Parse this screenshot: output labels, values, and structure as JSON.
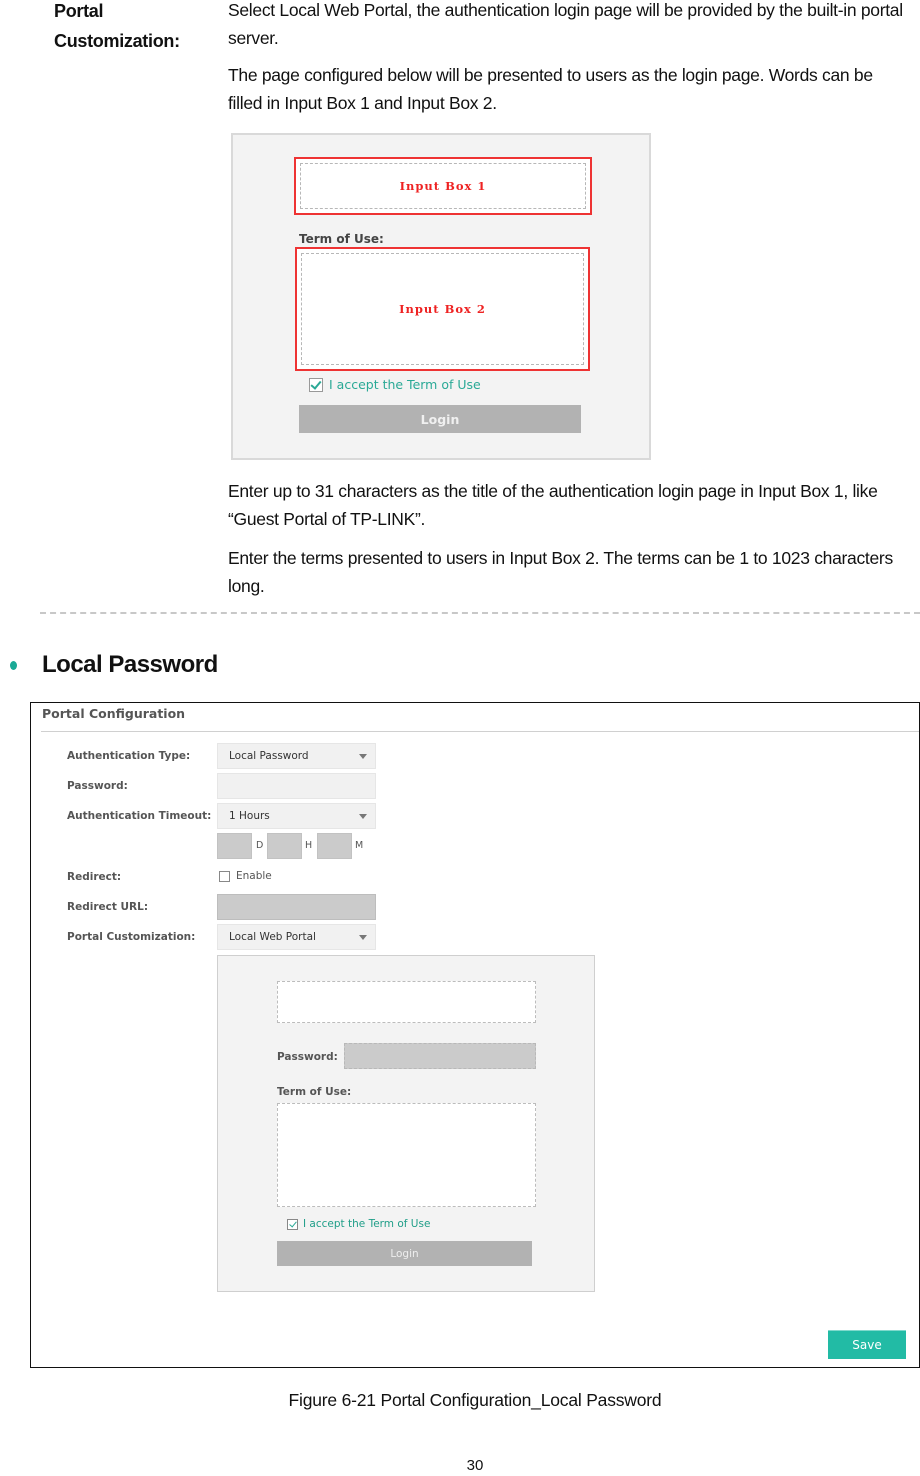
{
  "definition": {
    "term": "Portal Customization:",
    "paragraphs": [
      "Select Local Web Portal, the authentication login page will be provided by the built-in portal server.",
      "The page configured below will be presented to users as the login page. Words can be filled in Input Box 1 and Input Box 2.",
      "Enter up to 31 characters as the title of the authentication login page in Input Box 1, like “Guest Portal of TP-LINK”.",
      "Enter the terms presented to users in Input Box 2. The terms can be 1 to 1023 characters long."
    ]
  },
  "illustration": {
    "input_box_1": "Input Box 1",
    "term_of_use": "Term of Use:",
    "input_box_2": "Input Box 2",
    "accept_label": "I accept the Term of Use",
    "accept_checked": true,
    "login_label": "Login",
    "highlight_color": "#ee3333"
  },
  "section": {
    "title": "Local Password",
    "bullet_color": "#1aaa96"
  },
  "portal_config": {
    "title": "Portal Configuration",
    "fields": {
      "auth_type": {
        "label": "Authentication Type:",
        "value": "Local Password"
      },
      "password": {
        "label": "Password:",
        "value": ""
      },
      "auth_timeout": {
        "label": "Authentication Timeout:",
        "value": "1 Hours"
      },
      "custom_timeout": {
        "day_unit": "D",
        "hour_unit": "H",
        "minute_unit": "M"
      },
      "redirect": {
        "label": "Redirect:",
        "option": "Enable",
        "checked": false
      },
      "redirect_url": {
        "label": "Redirect URL:",
        "value": ""
      },
      "portal_customization": {
        "label": "Portal Customization:",
        "value": "Local Web Portal"
      }
    },
    "preview": {
      "password_label": "Password:",
      "term_label": "Term of Use:",
      "accept_label": "I accept the Term of Use",
      "accept_checked": true,
      "login_label": "Login"
    },
    "save_label": "Save",
    "accent_color": "#22bba5"
  },
  "caption": "Figure 6-21 Portal Configuration_Local Password",
  "page_number": "30"
}
